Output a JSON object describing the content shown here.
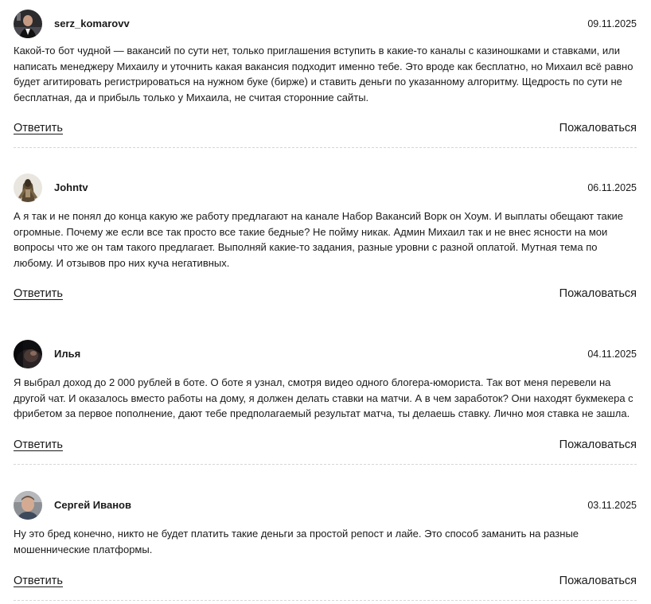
{
  "comments": [
    {
      "author": "serz_komarovv",
      "date": "09.11.2025",
      "text": "Какой-то бот чудной — вакансий по сути нет, только приглашения вступить в какие-то каналы с казиношками и ставками, или написать менеджеру Михаилу и уточнить какая вакансия подходит именно тебе. Это вроде как бесплатно, но Михаил всё равно будет агитировать регистрироваться на нужном буке (бирже) и ставить деньги по указанному алгоритму. Щедрость по сути не бесплатная, да и прибыль только у Михаила, не считая сторонние сайты.",
      "reply_label": "Ответить",
      "report_label": "Пожаловаться"
    },
    {
      "author": "Johntv",
      "date": "06.11.2025",
      "text": "А я так и не понял до конца какую же работу предлагают на канале Набор Вакансий Ворк он Хоум. И выплаты обещают такие огромные. Почему же если все так просто все такие бедные? Не пойму никак. Админ Михаил так и не внес ясности на мои вопросы что же он там такого предлагает. Выполняй какие-то задания, разные уровни с разной оплатой. Мутная тема по любому. И отзывов про них куча негативных.",
      "reply_label": "Ответить",
      "report_label": "Пожаловаться"
    },
    {
      "author": "Илья",
      "date": "04.11.2025",
      "text": "Я выбрал доход до 2 000 рублей в боте. О боте я узнал, смотря видео одного блогера-юмориста. Так вот меня перевели на другой чат. И оказалось вместо работы на дому, я должен делать ставки на матчи. А в чем заработок? Они находят букмекера с фрибетом за первое пополнение, дают тебе предполагаемый результат матча, ты делаешь ставку. Лично моя ставка не зашла.",
      "reply_label": "Ответить",
      "report_label": "Пожаловаться"
    },
    {
      "author": "Сергей Иванов",
      "date": "03.11.2025",
      "text": "Ну это бред конечно, никто не будет платить такие деньги за простой репост и лайе. Это способ заманить на разные мошеннические платформы.",
      "reply_label": "Ответить",
      "report_label": "Пожаловаться"
    }
  ],
  "colors": {
    "text": "#1a1a1a",
    "divider": "#d6d6d6"
  }
}
